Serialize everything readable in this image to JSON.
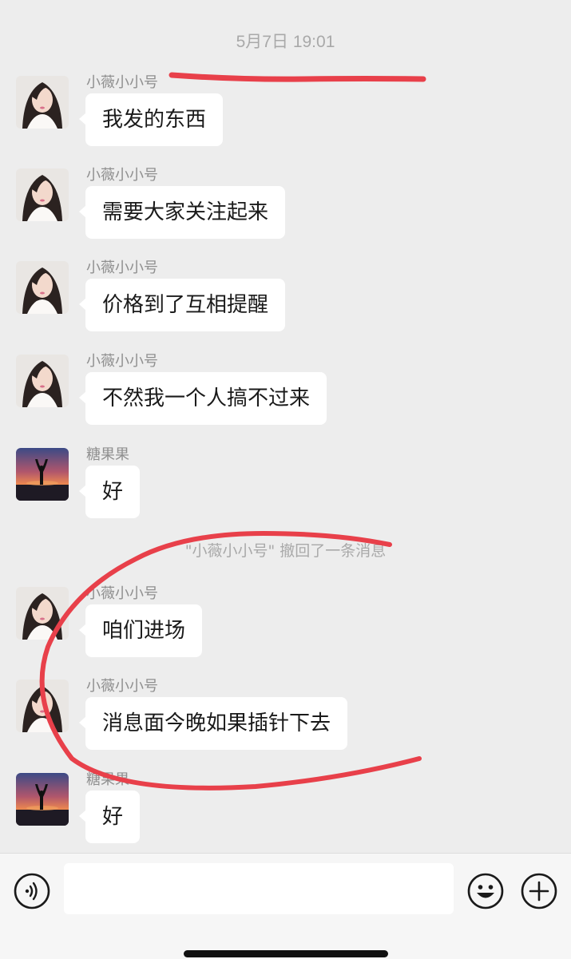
{
  "timestamp": "5月7日 19:01",
  "messages": [
    {
      "sender": "小薇小小号",
      "text": "我发的东西",
      "avatar": "woman-portrait"
    },
    {
      "sender": "小薇小小号",
      "text": "需要大家关注起来",
      "avatar": "woman-portrait"
    },
    {
      "sender": "小薇小小号",
      "text": "价格到了互相提醒",
      "avatar": "woman-portrait"
    },
    {
      "sender": "小薇小小号",
      "text": "不然我一个人搞不过来",
      "avatar": "woman-portrait"
    },
    {
      "sender": "糖果果",
      "text": "好",
      "avatar": "sunset-silhouette"
    },
    {
      "sender": "小薇小小号",
      "text": "咱们进场",
      "avatar": "woman-portrait"
    },
    {
      "sender": "小薇小小号",
      "text": "消息面今晚如果插针下去",
      "avatar": "woman-portrait"
    },
    {
      "sender": "糖果果",
      "text": "好",
      "avatar": "sunset-silhouette"
    }
  ],
  "system_notice": "\"小薇小小号\" 撤回了一条消息",
  "input": {
    "placeholder": "",
    "value": ""
  },
  "icons": {
    "voice": "voice-icon",
    "emoji": "emoji-icon",
    "more": "plus-icon"
  },
  "colors": {
    "background": "#ededed",
    "bubble": "#ffffff",
    "annotation": "#e8404a"
  }
}
